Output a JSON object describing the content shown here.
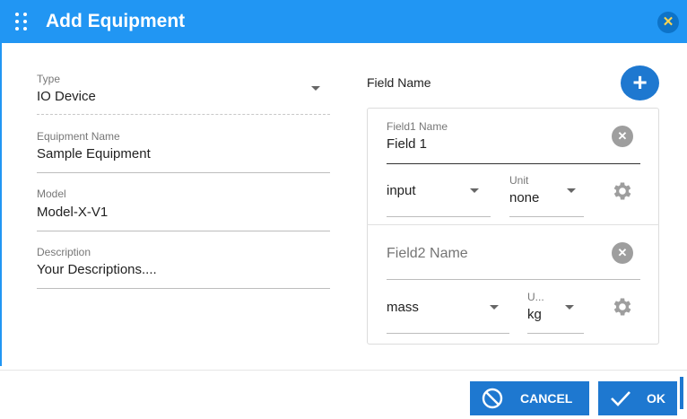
{
  "dialog": {
    "title": "Add Equipment",
    "close_symbol": "✕"
  },
  "form": {
    "type_label": "Type",
    "type_value": "IO Device",
    "name_label": "Equipment Name",
    "name_value": "Sample Equipment",
    "model_label": "Model",
    "model_value": "Model-X-V1",
    "description_label": "Description",
    "description_placeholder": "Your Descriptions...."
  },
  "fields": {
    "header": "Field Name",
    "add_symbol": "+",
    "items": [
      {
        "name_label": "Field1 Name",
        "name_value": "Field 1",
        "kind": "input",
        "unit_label": "Unit",
        "unit_value": "none"
      },
      {
        "name_placeholder": "Field2 Name",
        "kind": "mass",
        "unit_label": "U...",
        "unit_value": "kg"
      }
    ]
  },
  "footer": {
    "cancel_label": "CANCEL",
    "ok_label": "OK"
  },
  "icons": {
    "drag": "drag-handle-icon",
    "close": "close-icon",
    "add": "add-icon",
    "clear": "clear-icon",
    "settings": "gear-icon",
    "cancel": "cancel-icon",
    "ok": "check-icon"
  },
  "colors": {
    "primary": "#2196f3",
    "button": "#1e78d0",
    "close_x": "#ffd54f"
  }
}
